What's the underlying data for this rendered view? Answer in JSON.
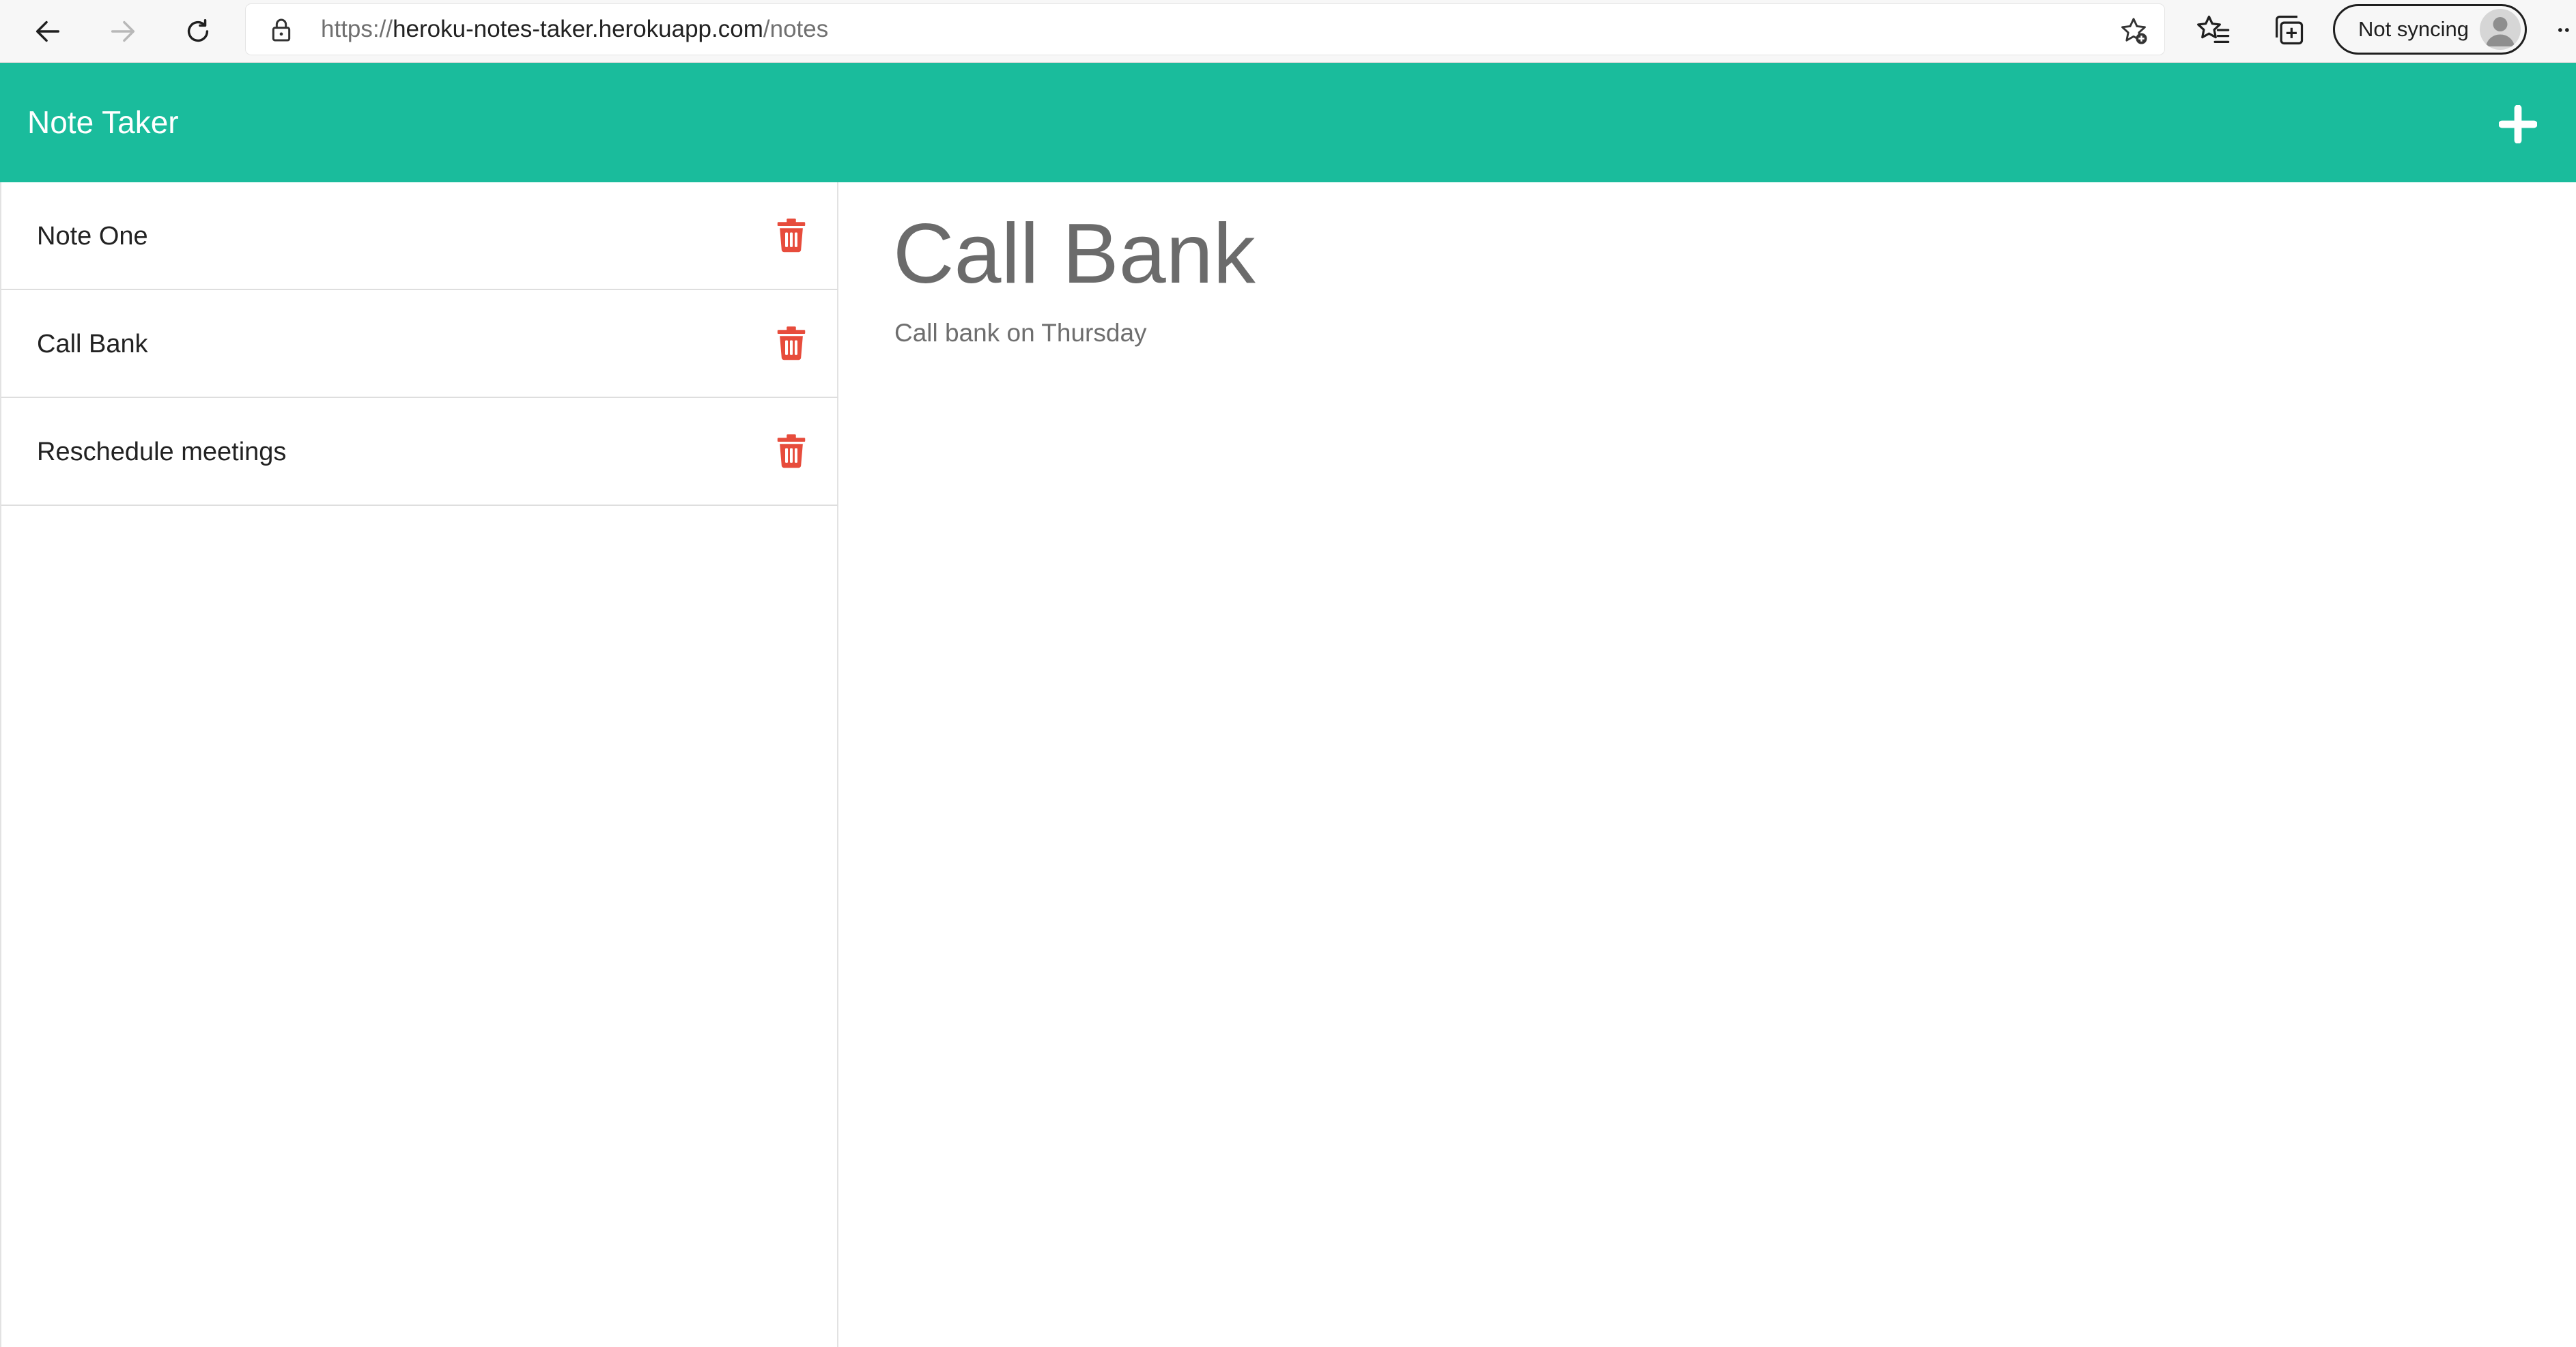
{
  "browser": {
    "url_prefix": "https://",
    "url_host": "heroku-notes-taker.herokuapp.com",
    "url_path": "/notes",
    "sync_label": "Not syncing",
    "icons": [
      "back-arrow-icon",
      "forward-arrow-icon",
      "refresh-icon",
      "lock-icon",
      "add-favorite-icon",
      "favorites-icon",
      "collections-icon",
      "profile-avatar-icon",
      "more-icon"
    ]
  },
  "header": {
    "title": "Note Taker",
    "new_note_icon": "plus-icon",
    "color": "#1abc9c"
  },
  "notes": [
    {
      "title": "Note One"
    },
    {
      "title": "Call Bank"
    },
    {
      "title": "Reschedule meetings"
    }
  ],
  "active_note": {
    "title": "Call Bank",
    "text": "Call bank on Thursday"
  },
  "colors": {
    "accent": "#1abc9c",
    "delete": "#e74c3c"
  }
}
